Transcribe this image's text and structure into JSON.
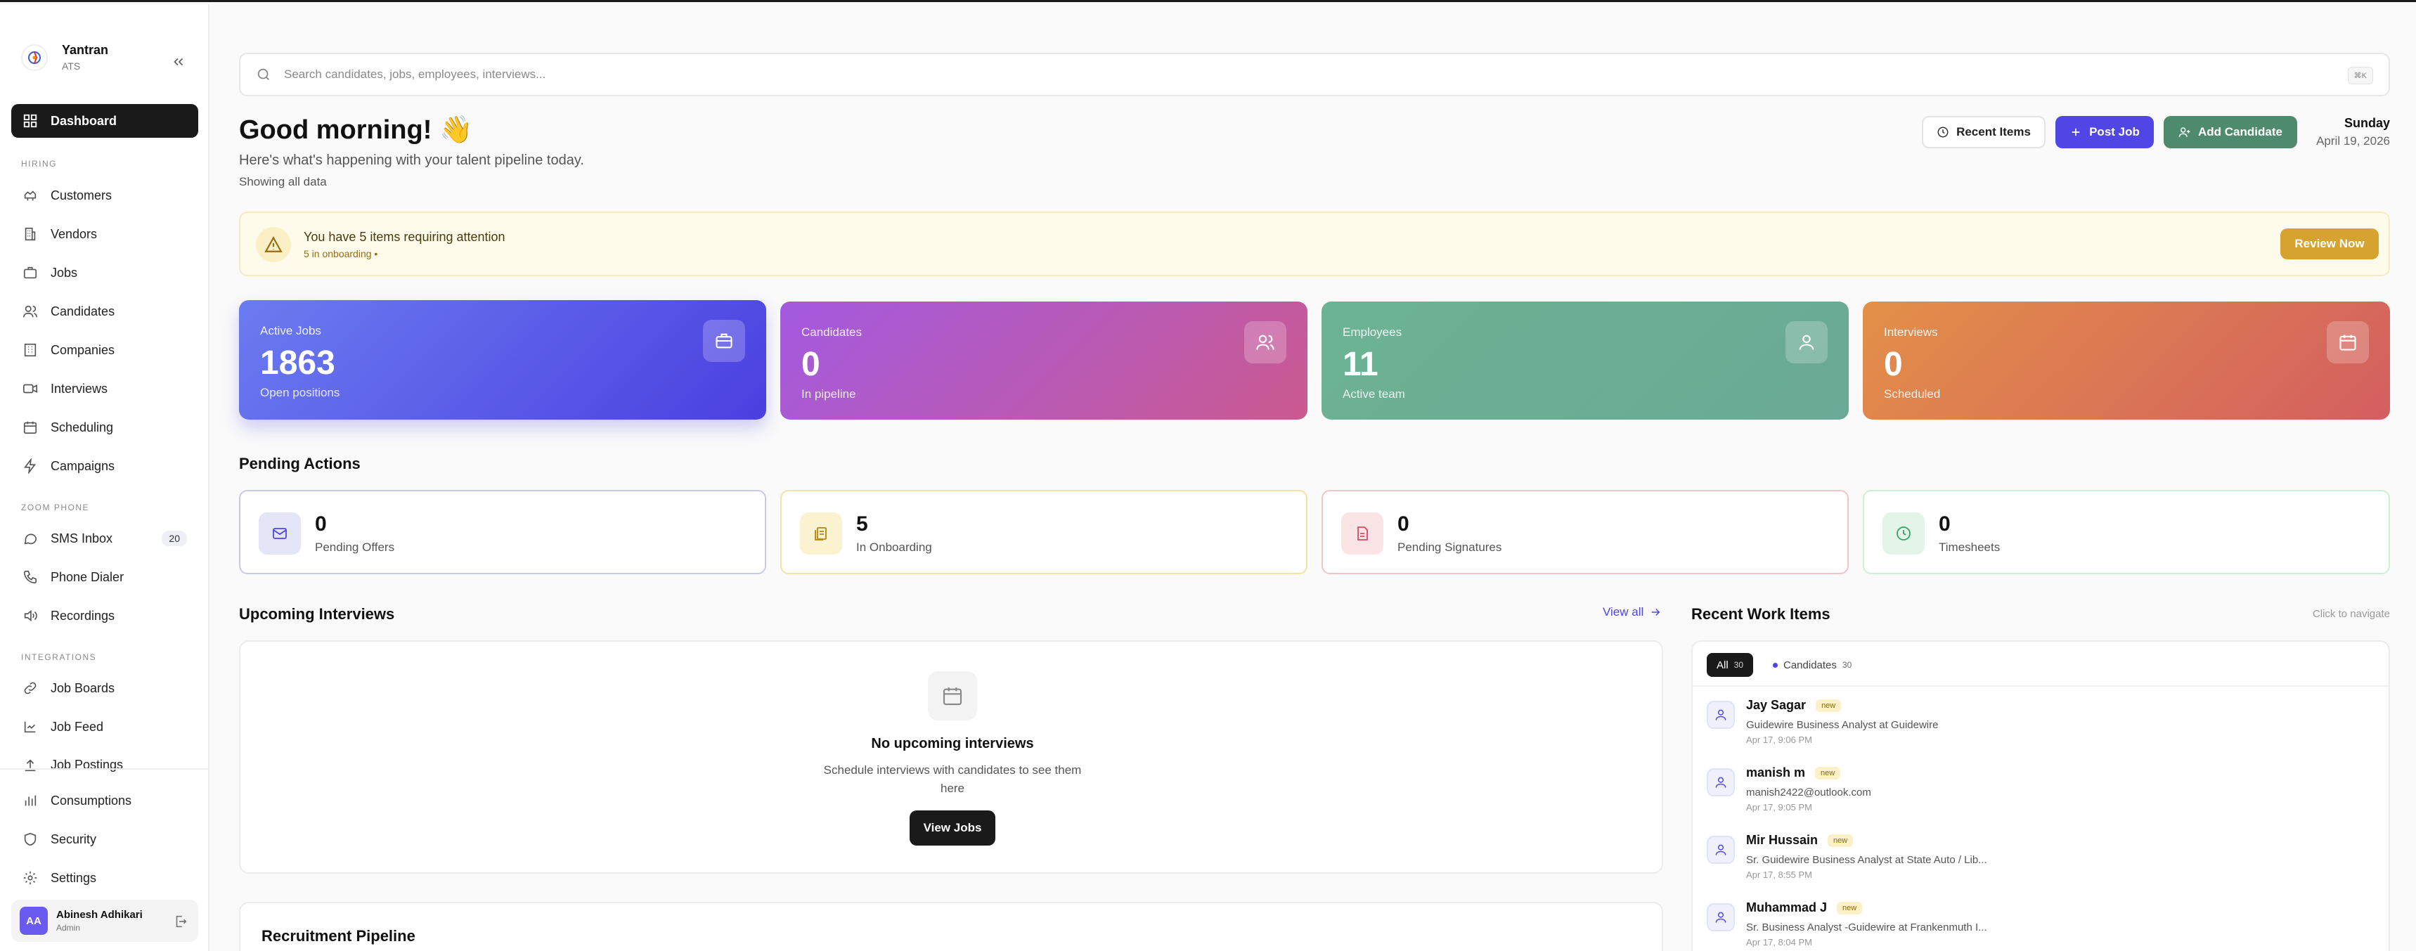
{
  "brand": {
    "name": "Yantran",
    "sub": "ATS"
  },
  "sidebar": {
    "dashboard": "Dashboard",
    "sections": {
      "hiring": "HIRING",
      "zoom": "ZOOM PHONE",
      "integrations": "INTEGRATIONS"
    },
    "hiring": [
      "Customers",
      "Vendors",
      "Jobs",
      "Candidates",
      "Companies",
      "Interviews",
      "Scheduling",
      "Campaigns"
    ],
    "zoom": [
      "SMS Inbox",
      "Phone Dialer",
      "Recordings"
    ],
    "sms_badge": "20",
    "integrations": [
      "Job Boards",
      "Job Feed",
      "Job Postings"
    ],
    "bottom": [
      "Consumptions",
      "Security",
      "Settings"
    ]
  },
  "user": {
    "initials": "AA",
    "name": "Abinesh Adhikari",
    "role": "Admin"
  },
  "search": {
    "placeholder": "Search candidates, jobs, employees, interviews...",
    "shortcut": "⌘K"
  },
  "header": {
    "greeting": "Good morning! 👋",
    "subtitle": "Here's what's happening with your talent pipeline today.",
    "showing": "Showing all data",
    "recent": "Recent Items",
    "post": "Post Job",
    "add": "Add Candidate",
    "day": "Sunday",
    "date": "April 19, 2026"
  },
  "alert": {
    "title": "You have 5 items requiring attention",
    "sub": "5 in onboarding •",
    "button": "Review Now"
  },
  "stats": [
    {
      "label": "Active Jobs",
      "value": "1863",
      "caption": "Open positions"
    },
    {
      "label": "Candidates",
      "value": "0",
      "caption": "In pipeline"
    },
    {
      "label": "Employees",
      "value": "11",
      "caption": "Active team"
    },
    {
      "label": "Interviews",
      "value": "0",
      "caption": "Scheduled"
    }
  ],
  "pending": {
    "title": "Pending Actions",
    "items": [
      {
        "value": "0",
        "label": "Pending Offers"
      },
      {
        "value": "5",
        "label": "In Onboarding"
      },
      {
        "value": "0",
        "label": "Pending Signatures"
      },
      {
        "value": "0",
        "label": "Timesheets"
      }
    ]
  },
  "interviews": {
    "title": "Upcoming Interviews",
    "view_all": "View all",
    "empty_title": "No upcoming interviews",
    "empty_sub": "Schedule interviews with candidates to see them here",
    "button": "View Jobs"
  },
  "pipeline": {
    "title": "Recruitment Pipeline"
  },
  "work": {
    "title": "Recent Work Items",
    "hint": "Click to navigate",
    "tab_all": "All",
    "tab_all_count": "30",
    "tab_cand": "Candidates",
    "tab_cand_count": "30",
    "items": [
      {
        "name": "Jay Sagar",
        "badge": "new",
        "desc": "Guidewire Business Analyst at Guidewire",
        "time": "Apr 17, 9:06 PM"
      },
      {
        "name": "manish m",
        "badge": "new",
        "desc": "manish2422@outlook.com",
        "time": "Apr 17, 9:05 PM"
      },
      {
        "name": "Mir Hussain",
        "badge": "new",
        "desc": "Sr. Guidewire Business Analyst at State Auto / Lib...",
        "time": "Apr 17, 8:55 PM"
      },
      {
        "name": "Muhammad J",
        "badge": "new",
        "desc": "Sr. Business Analyst -Guidewire at Frankenmuth I...",
        "time": "Apr 17, 8:04 PM"
      }
    ]
  },
  "colors": {
    "primary": "#4f46e5",
    "green": "#4e8a6c",
    "amber": "#d6a230",
    "dark": "#1a1a1a"
  }
}
